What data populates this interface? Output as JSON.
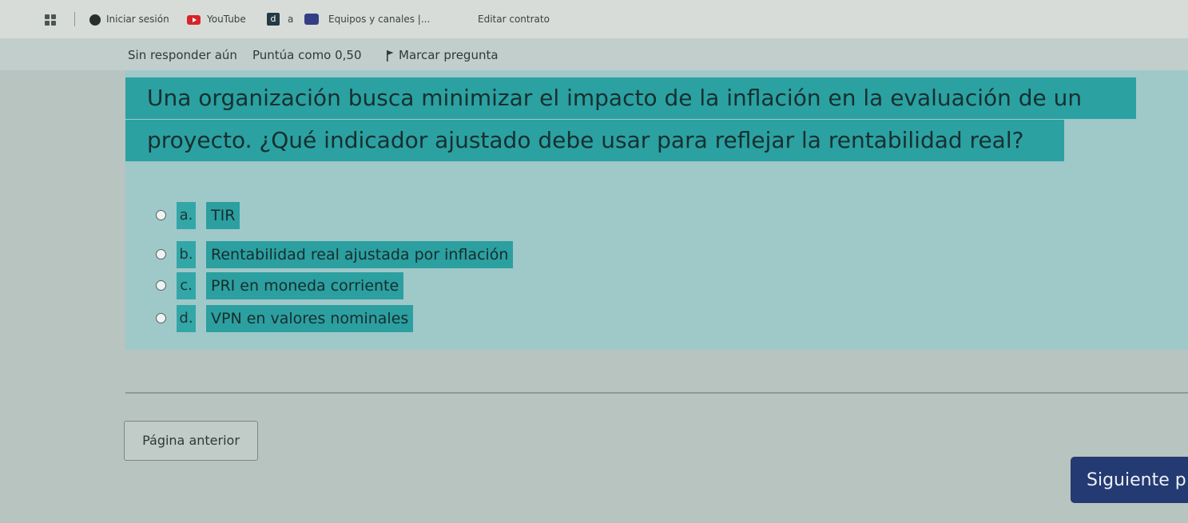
{
  "bookmarks": {
    "items": [
      {
        "label": "Iniciar sesión",
        "icon": "user-circle-icon"
      },
      {
        "label": "YouTube",
        "icon": "youtube-icon"
      },
      {
        "label": "a",
        "icon": "d-app-icon"
      },
      {
        "label": "Equipos y canales |...",
        "icon": "teams-icon"
      },
      {
        "label": "Editar contrato"
      }
    ]
  },
  "question_info": {
    "status": "Sin responder aún",
    "grade": "Puntúa como 0,50",
    "flag_label": "Marcar pregunta"
  },
  "question": {
    "text_line1": "Una organización busca minimizar el impacto de la inflación en la evaluación de un",
    "text_line2": "proyecto. ¿Qué indicador ajustado debe usar para reflejar la rentabilidad real?",
    "options": [
      {
        "letter": "a.",
        "text": "TIR"
      },
      {
        "letter": "b.",
        "text": "Rentabilidad real ajustada por inflación"
      },
      {
        "letter": "c.",
        "text": "PRI en moneda corriente"
      },
      {
        "letter": "d.",
        "text": "VPN en valores nominales"
      }
    ]
  },
  "navigation": {
    "prev_label": "Página anterior",
    "next_label": "Siguiente p"
  },
  "colors": {
    "highlight": "#2ba1a2",
    "panel": "#9fc8c9",
    "next_button": "#243a72"
  }
}
